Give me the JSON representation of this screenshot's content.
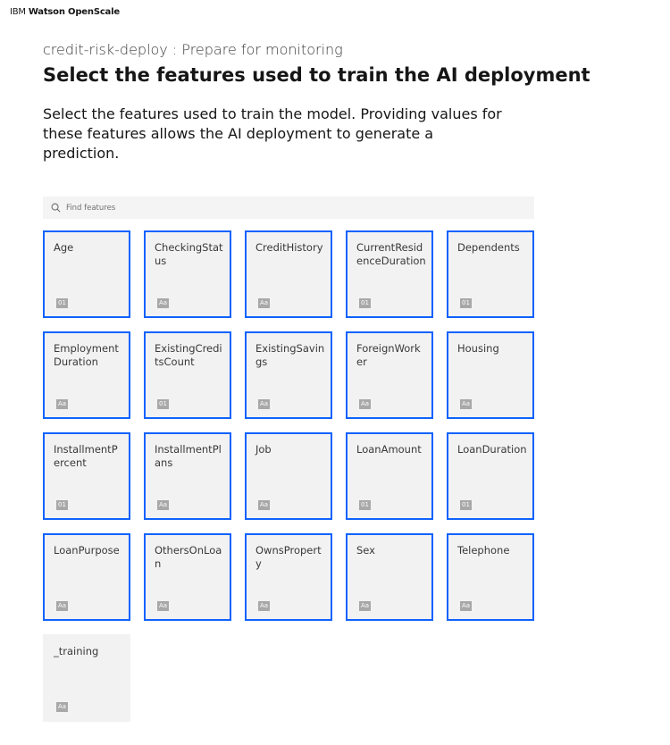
{
  "app": {
    "brand_prefix": "IBM",
    "brand_product": "Watson OpenScale"
  },
  "header": {
    "subtitle": "credit-risk-deploy : Prepare for monitoring",
    "title": "Select the features used to train the AI deployment",
    "description": "Select the features used to train the model. Providing values for these features allows the AI deployment to generate a prediction."
  },
  "search": {
    "placeholder": "Find features",
    "value": ""
  },
  "colors": {
    "selected_border": "#0f62fe",
    "tile_background": "#f2f2f2",
    "badge_background": "#a8a8a8"
  },
  "features": [
    {
      "label": "Age",
      "type": "01",
      "selected": true
    },
    {
      "label": "CheckingStatus",
      "type": "Aa",
      "selected": true
    },
    {
      "label": "CreditHistory",
      "type": "Aa",
      "selected": true
    },
    {
      "label": "CurrentResidenceDuration",
      "type": "01",
      "selected": true
    },
    {
      "label": "Dependents",
      "type": "01",
      "selected": true
    },
    {
      "label": "EmploymentDuration",
      "type": "Aa",
      "selected": true
    },
    {
      "label": "ExistingCreditsCount",
      "type": "01",
      "selected": true
    },
    {
      "label": "ExistingSavings",
      "type": "Aa",
      "selected": true
    },
    {
      "label": "ForeignWorker",
      "type": "Aa",
      "selected": true
    },
    {
      "label": "Housing",
      "type": "Aa",
      "selected": true
    },
    {
      "label": "InstallmentPercent",
      "type": "01",
      "selected": true
    },
    {
      "label": "InstallmentPlans",
      "type": "Aa",
      "selected": true
    },
    {
      "label": "Job",
      "type": "Aa",
      "selected": true
    },
    {
      "label": "LoanAmount",
      "type": "01",
      "selected": true
    },
    {
      "label": "LoanDuration",
      "type": "01",
      "selected": true
    },
    {
      "label": "LoanPurpose",
      "type": "Aa",
      "selected": true
    },
    {
      "label": "OthersOnLoan",
      "type": "Aa",
      "selected": true
    },
    {
      "label": "OwnsProperty",
      "type": "Aa",
      "selected": true
    },
    {
      "label": "Sex",
      "type": "Aa",
      "selected": true
    },
    {
      "label": "Telephone",
      "type": "Aa",
      "selected": true
    },
    {
      "label": "_training",
      "type": "Aa",
      "selected": false
    }
  ]
}
